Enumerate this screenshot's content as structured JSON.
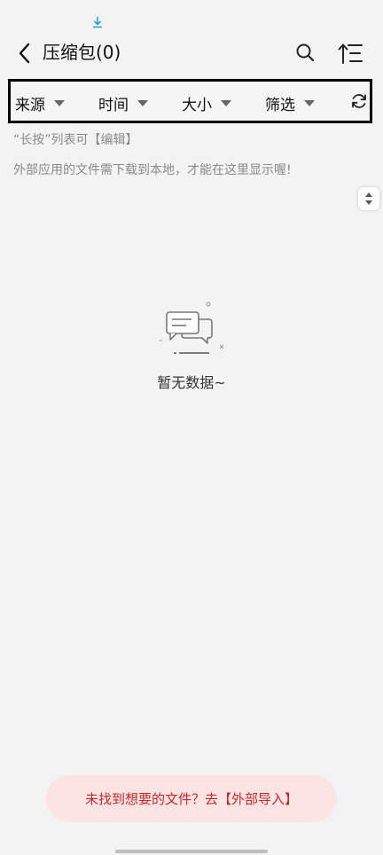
{
  "header": {
    "title": "压缩包(0)"
  },
  "filters": [
    {
      "label": "来源"
    },
    {
      "label": "时间"
    },
    {
      "label": "大小"
    },
    {
      "label": "筛选"
    }
  ],
  "hints": {
    "long_press": "“长按”列表可【编辑】",
    "external_apps": "外部应用的文件需下载到本地，才能在这里显示喔!"
  },
  "empty": {
    "text": "暂无数据~"
  },
  "import_button": {
    "label": "未找到想要的文件？去【外部导入】"
  },
  "colors": {
    "background": "#f3f3f3",
    "accent_pill_bg": "#fde4e4",
    "accent_pill_text": "#c62828",
    "download_icon": "#2aa7c9"
  },
  "icons": [
    "download-icon",
    "back-icon",
    "search-icon",
    "sort-icon",
    "refresh-icon",
    "scroll-toggle-icon",
    "empty-chat-icon"
  ]
}
